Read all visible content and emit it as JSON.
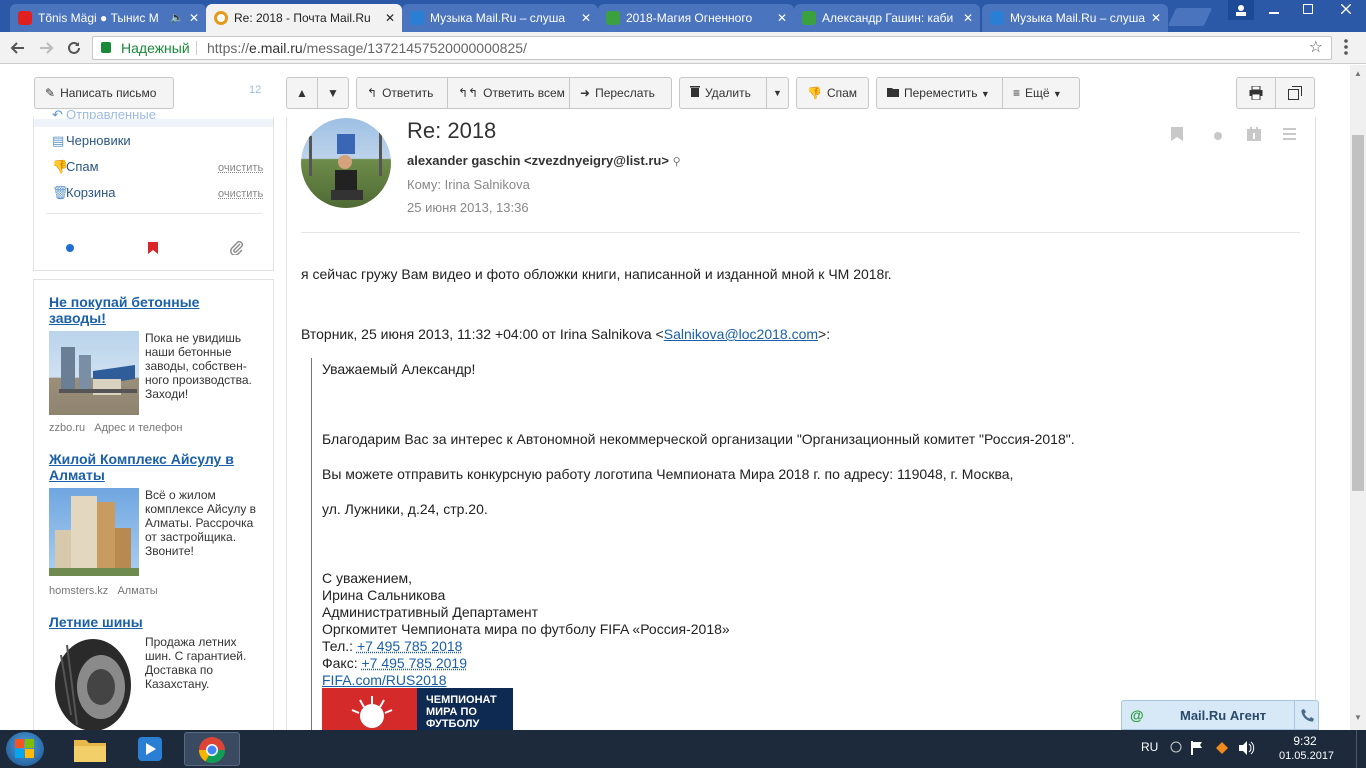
{
  "browser": {
    "tabs": [
      {
        "title": "Tõnis Mägi ● Тынис М",
        "favicon_color": "#e02020"
      },
      {
        "title": "Re: 2018 - Почта Mail.Ru",
        "favicon_color": "#1e6fd0",
        "active": true
      },
      {
        "title": "Музыка Mail.Ru – слуша",
        "favicon_color": "#2a7fd4"
      },
      {
        "title": "2018-Магия Огненного",
        "favicon_color": "#3aa040"
      },
      {
        "title": "Александр Гашин: каби",
        "favicon_color": "#3aa040"
      },
      {
        "title": "Музыка Mail.Ru – слуша",
        "favicon_color": "#2a7fd4"
      }
    ],
    "close_glyph": "✕",
    "mute_glyph": "🔈",
    "secure_label": "Надежный",
    "url_scheme": "https://",
    "url_domain": "e.mail.ru",
    "url_path": "/message/13721457520000000825/"
  },
  "toolbar": {
    "compose": "Написать письмо",
    "unread_count": "12",
    "reply": "Ответить",
    "reply_all": "Ответить всем",
    "forward": "Переслать",
    "delete": "Удалить",
    "spam": "Спам",
    "move": "Переместить",
    "more": "Ещё"
  },
  "sidebar": {
    "sent_partial": "Отправленные",
    "folders": [
      {
        "label": "Черновики"
      },
      {
        "label": "Спам",
        "action": "очистить"
      },
      {
        "label": "Корзина",
        "action": "очистить"
      }
    ]
  },
  "ads": [
    {
      "title": "Не покупай бетонные заводы!",
      "text": "Пока не увидишь наши бетонные заводы, собствен-ного производства. Заходи!",
      "domain": "zzbo.ru",
      "extra": "Адрес и телефон"
    },
    {
      "title": "Жилой Комплекс Айсулу в Алматы",
      "text": "Всё о жилом комплексе Айсулу в Алматы. Рассрочка от застройщика. Звоните!",
      "domain": "homsters.kz",
      "extra": "Алматы"
    },
    {
      "title": "Летние шины",
      "text": "Продажа летних шин. С гарантией. Доставка по Казахстану."
    }
  ],
  "message": {
    "subject": "Re: 2018",
    "from": "alexander gaschin <zvezdnyeigry@list.ru>",
    "to_label": "Кому:",
    "to": "Irina Salnikova",
    "date": "25 июня 2013, 13:36",
    "body_line": "я сейчас гружу Вам видео и фото обложки книги, написанной и изданной мной к ЧМ 2018г.",
    "quote_header_prefix": "Вторник, 25 июня 2013, 11:32 +04:00 от Irina Salnikova <",
    "quote_header_email": "Salnikova@loc2018.com",
    "quote_header_suffix": ">:",
    "quote": {
      "greeting": "Уважаемый Александр!",
      "p1": "Благодарим Вас за интерес к Автономной некоммерческой организации \"Организационный комитет \"Россия-2018\".",
      "p2": "Вы можете отправить конкурсную работу логотипа Чемпионата Мира 2018 г. по адресу: 119048, г. Москва,",
      "p3": "ул. Лужники, д.24, стр.20.",
      "sig1": "С уважением,",
      "sig2": "Ирина Сальникова",
      "sig3": "Административный Департамент",
      "sig4": "Оргкомитет Чемпионата мира по футболу FIFA «Россия-2018»",
      "tel_label": "Тел.:",
      "tel": "+7 495 785 2018",
      "fax_label": "Факс:",
      "fax": "+7 495 785 2019",
      "site": "FIFA.com/RUS2018",
      "banner_text1": "ЧЕМПИОНАТ",
      "banner_text2": "МИРА ПО",
      "banner_text3": "ФУТБОЛУ"
    }
  },
  "agent": {
    "label": "Mail.Ru Агент"
  },
  "taskbar": {
    "lang": "RU",
    "time": "9:32",
    "date": "01.05.2017"
  }
}
